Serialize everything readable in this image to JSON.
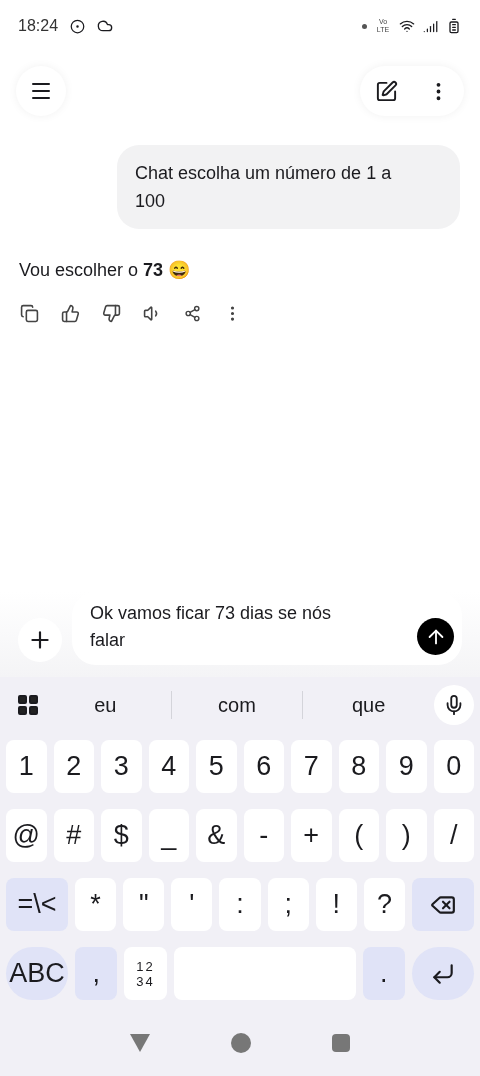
{
  "status_bar": {
    "time": "18:24",
    "network": "Vo LTE"
  },
  "chat": {
    "user_message": "Chat escolha um número de 1 a 100",
    "reply": "Vou escolher o **73** 😄"
  },
  "composer": {
    "value": "Ok vamos ficar 73 dias se nós falar"
  },
  "keyboard": {
    "suggestions": [
      "eu",
      "com",
      "que"
    ],
    "rows": [
      [
        {
          "kind": "char",
          "label": "1"
        },
        {
          "kind": "char",
          "label": "2"
        },
        {
          "kind": "char",
          "label": "3"
        },
        {
          "kind": "char",
          "label": "4"
        },
        {
          "kind": "char",
          "label": "5"
        },
        {
          "kind": "char",
          "label": "6"
        },
        {
          "kind": "char",
          "label": "7"
        },
        {
          "kind": "char",
          "label": "8"
        },
        {
          "kind": "char",
          "label": "9"
        },
        {
          "kind": "char",
          "label": "0"
        }
      ],
      [
        {
          "kind": "char",
          "label": "@"
        },
        {
          "kind": "char",
          "label": "#"
        },
        {
          "kind": "char",
          "label": "$"
        },
        {
          "kind": "char",
          "label": "_"
        },
        {
          "kind": "char",
          "label": "&"
        },
        {
          "kind": "char",
          "label": "-"
        },
        {
          "kind": "char",
          "label": "+"
        },
        {
          "kind": "char",
          "label": "("
        },
        {
          "kind": "char",
          "label": ")"
        },
        {
          "kind": "char",
          "label": "/"
        }
      ],
      [
        {
          "kind": "special",
          "label": "=\\<"
        },
        {
          "kind": "char",
          "label": "*"
        },
        {
          "kind": "char",
          "label": "\""
        },
        {
          "kind": "char",
          "label": "'"
        },
        {
          "kind": "char",
          "label": ":"
        },
        {
          "kind": "char",
          "label": ";"
        },
        {
          "kind": "char",
          "label": "!"
        },
        {
          "kind": "char",
          "label": "?"
        },
        {
          "kind": "backspace"
        }
      ],
      [
        {
          "kind": "round",
          "label": "ABC"
        },
        {
          "kind": "special",
          "label": ","
        },
        {
          "kind": "stacked",
          "lines": [
            "12",
            "34"
          ]
        },
        {
          "kind": "space"
        },
        {
          "kind": "special",
          "label": "."
        },
        {
          "kind": "enter"
        }
      ]
    ]
  }
}
